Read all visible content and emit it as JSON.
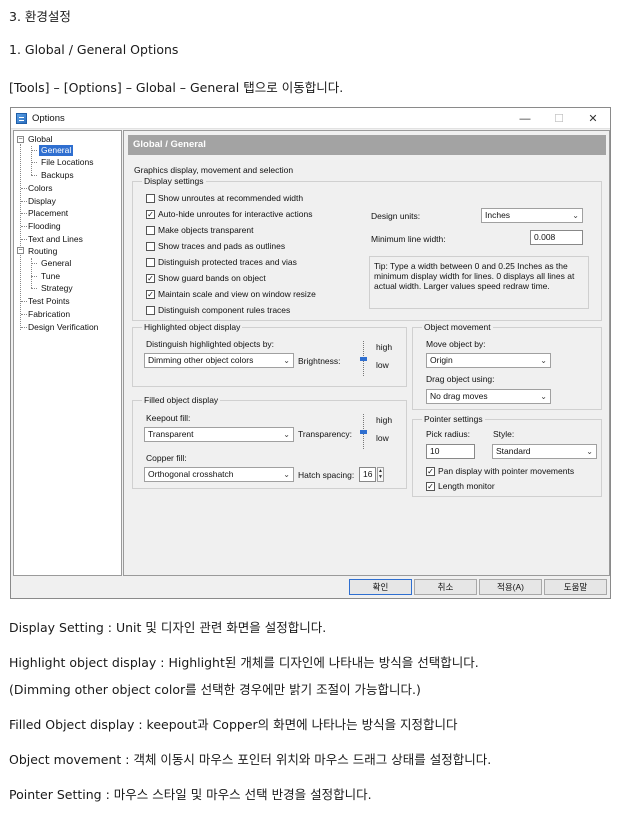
{
  "doc": {
    "heading": "3. 환경설정",
    "subheading": "1. Global / General Options",
    "path_text": "[Tools] – [Options] – Global – General 탭으로 이동합니다.",
    "notes": [
      "Display Setting : Unit 및 디자인 관련 화면을 설정합니다.",
      "Highlight object display : Highlight된 개체를 디자인에 나타내는 방식을 선택합니다.",
      "(Dimming other object color를 선택한 경우에만 밝기 조절이 가능합니다.)",
      "Filled Object display : keepout과 Copper의 화면에 나타나는 방식을 지정합니다",
      "Object movement : 객체 이동시 마우스 포인터 위치와 마우스 드래그 상태를 설정합니다.",
      "Pointer Setting : 마우스 스타일 및 마우스 선택 반경을 설정합니다."
    ]
  },
  "window": {
    "title": "Options",
    "minimize": "—",
    "maximize": "☐",
    "close": "✕"
  },
  "tree": {
    "items": [
      {
        "label": "Global"
      },
      {
        "label": "General"
      },
      {
        "label": "File Locations"
      },
      {
        "label": "Backups"
      },
      {
        "label": "Colors"
      },
      {
        "label": "Display"
      },
      {
        "label": "Placement"
      },
      {
        "label": "Flooding"
      },
      {
        "label": "Text and Lines"
      },
      {
        "label": "Routing"
      },
      {
        "label": "General"
      },
      {
        "label": "Tune"
      },
      {
        "label": "Strategy"
      },
      {
        "label": "Test Points"
      },
      {
        "label": "Fabrication"
      },
      {
        "label": "Design Verification"
      }
    ],
    "expander_minus": "−"
  },
  "panel": {
    "header": "Global / General",
    "section_title": "Graphics display, movement and selection",
    "display_settings": {
      "legend": "Display settings",
      "checks": [
        {
          "label": "Show unroutes at recommended width",
          "checked": false
        },
        {
          "label": "Auto-hide unroutes for interactive actions",
          "checked": true
        },
        {
          "label": "Make objects transparent",
          "checked": false
        },
        {
          "label": "Show traces and pads as outlines",
          "checked": false
        },
        {
          "label": "Distinguish protected traces and vias",
          "checked": false
        },
        {
          "label": "Show guard bands on object",
          "checked": true
        },
        {
          "label": "Maintain scale and view on window resize",
          "checked": true
        },
        {
          "label": "Distinguish component rules traces",
          "checked": false
        }
      ],
      "design_units_label": "Design units:",
      "design_units_value": "Inches",
      "min_line_width_label": "Minimum line width:",
      "min_line_width_value": "0.008",
      "tip": "Tip: Type a width between 0 and 0.25 Inches as the minimum display width for lines. 0 displays all lines at actual width. Larger values speed redraw time."
    },
    "highlighted": {
      "legend": "Highlighted object display",
      "distinguish_label": "Distinguish highlighted objects by:",
      "distinguish_value": "Dimming other object colors",
      "brightness_label": "Brightness:",
      "high": "high",
      "low": "low"
    },
    "filled": {
      "legend": "Filled object display",
      "keepout_label": "Keepout fill:",
      "keepout_value": "Transparent",
      "transparency_label": "Transparency:",
      "high": "high",
      "low": "low",
      "copper_label": "Copper fill:",
      "copper_value": "Orthogonal crosshatch",
      "hatch_label": "Hatch spacing:",
      "hatch_value": "16"
    },
    "movement": {
      "legend": "Object movement",
      "move_label": "Move object by:",
      "move_value": "Origin",
      "drag_label": "Drag object using:",
      "drag_value": "No drag moves"
    },
    "pointer": {
      "legend": "Pointer settings",
      "pick_label": "Pick radius:",
      "pick_value": "10",
      "style_label": "Style:",
      "style_value": "Standard",
      "checks": [
        {
          "label": "Pan display with pointer movements",
          "checked": true
        },
        {
          "label": "Length monitor",
          "checked": true
        }
      ]
    }
  },
  "buttons": {
    "ok": "확인",
    "cancel": "취소",
    "apply": "적용(A)",
    "help": "도움말"
  },
  "glyphs": {
    "check": "✓",
    "chevron": "⌄",
    "up": "▲",
    "down": "▼"
  }
}
